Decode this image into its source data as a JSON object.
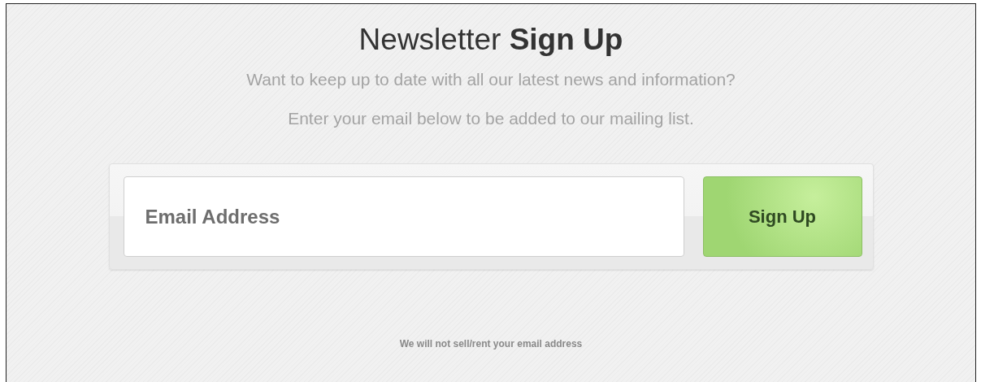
{
  "heading": "Newsletter **Sign Up**",
  "intro": [
    "Want to keep up to date with all our latest news and information?",
    "Enter your email below to be added to our mailing list."
  ],
  "form": {
    "email": {
      "placeholder": "Email Address"
    },
    "submit": "Sign Up"
  },
  "privacy_note": "We will not sell/rent your email address"
}
